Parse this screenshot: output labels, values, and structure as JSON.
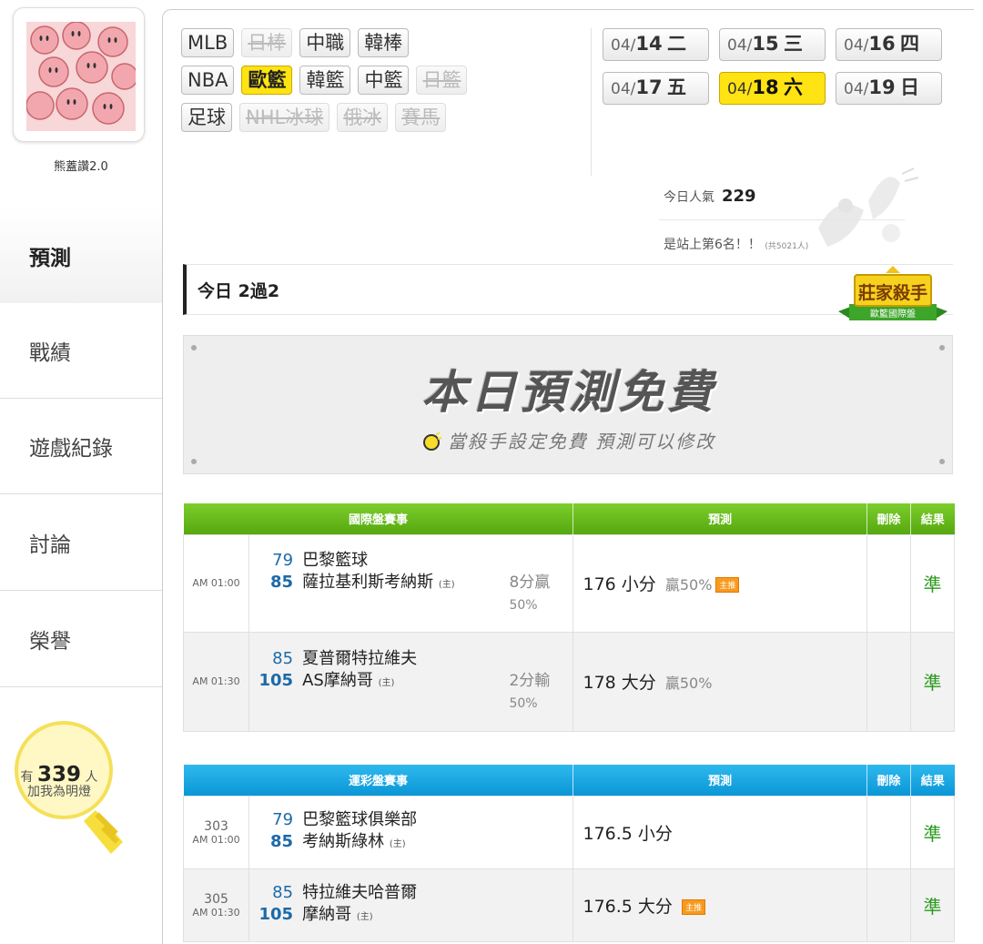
{
  "user": {
    "name": "熊蓋讚2.0"
  },
  "nav": [
    {
      "label": "預測",
      "active": true
    },
    {
      "label": "戰績",
      "active": false
    },
    {
      "label": "遊戲紀錄",
      "active": false
    },
    {
      "label": "討論",
      "active": false
    },
    {
      "label": "榮譽",
      "active": false
    }
  ],
  "fans": {
    "prefix": "有",
    "count": "339",
    "suffix": "人",
    "line2": "加我為明燈"
  },
  "leagues": [
    [
      {
        "label": "MLB",
        "state": "normal"
      },
      {
        "label": "日棒",
        "state": "disabled"
      },
      {
        "label": "中職",
        "state": "normal"
      },
      {
        "label": "韓棒",
        "state": "normal"
      }
    ],
    [
      {
        "label": "NBA",
        "state": "normal"
      },
      {
        "label": "歐籃",
        "state": "selected"
      },
      {
        "label": "韓籃",
        "state": "normal"
      },
      {
        "label": "中籃",
        "state": "normal"
      },
      {
        "label": "日籃",
        "state": "disabled"
      }
    ],
    [
      {
        "label": "足球",
        "state": "normal"
      },
      {
        "label": "NHL冰球",
        "state": "disabled"
      },
      {
        "label": "俄冰",
        "state": "disabled"
      },
      {
        "label": "賽馬",
        "state": "disabled"
      }
    ]
  ],
  "dates": [
    [
      {
        "md": "04/",
        "d": "14",
        "wd": "二",
        "selected": false
      },
      {
        "md": "04/",
        "d": "15",
        "wd": "三",
        "selected": false
      },
      {
        "md": "04/",
        "d": "16",
        "wd": "四",
        "selected": false
      }
    ],
    [
      {
        "md": "04/",
        "d": "17",
        "wd": "五",
        "selected": false
      },
      {
        "md": "04/",
        "d": "18",
        "wd": "六",
        "selected": true
      },
      {
        "md": "04/",
        "d": "19",
        "wd": "日",
        "selected": false
      }
    ]
  ],
  "stats": {
    "popularity_label": "今日人氣",
    "popularity_value": "229",
    "rank_text": "是站上第6名！！",
    "rank_total": "(共5021人)"
  },
  "today": {
    "label": "今日 2過2"
  },
  "badge": {
    "title": "莊家殺手",
    "sub": "歐籃國際盤"
  },
  "free_banner": {
    "title": "本日預測免費",
    "subtitle": "當殺手設定免費 預測可以修改"
  },
  "table_intl": {
    "headers": {
      "event": "國際盤賽事",
      "prediction": "預測",
      "delete": "刪除",
      "result": "結果"
    },
    "rows": [
      {
        "no": "",
        "time": "AM 01:00",
        "away_score": "79",
        "away": "巴黎籃球",
        "home_score": "85",
        "home": "薩拉基利斯考納斯",
        "home_tag": "(主)",
        "line": "8分贏",
        "line_pct": "50%",
        "pred": "176 小分",
        "pred_pct": "贏50%",
        "main": "主推",
        "result": "準"
      },
      {
        "no": "",
        "time": "AM 01:30",
        "away_score": "85",
        "away": "夏普爾特拉維夫",
        "home_score": "105",
        "home": "AS摩納哥",
        "home_tag": "(主)",
        "line": "2分輸",
        "line_pct": "50%",
        "pred": "178 大分",
        "pred_pct": "贏50%",
        "main": "",
        "result": "準"
      }
    ]
  },
  "table_sports": {
    "headers": {
      "event": "運彩盤賽事",
      "prediction": "預測",
      "delete": "刪除",
      "result": "結果"
    },
    "rows": [
      {
        "no": "303",
        "time": "AM 01:00",
        "away_score": "79",
        "away": "巴黎籃球俱樂部",
        "home_score": "85",
        "home": "考納斯綠林",
        "home_tag": "(主)",
        "pred": "176.5 小分",
        "main": "",
        "result": "準"
      },
      {
        "no": "305",
        "time": "AM 01:30",
        "away_score": "85",
        "away": "特拉維夫哈普爾",
        "home_score": "105",
        "home": "摩納哥",
        "home_tag": "(主)",
        "pred": "176.5 大分",
        "main": "主推",
        "result": "準"
      }
    ]
  },
  "colors": {
    "accent_yellow": "#ffe312",
    "green_header": "#55a80f",
    "blue_header": "#0a97d6",
    "result_green": "#2a9a1c",
    "score_blue": "#1c6aa8"
  }
}
